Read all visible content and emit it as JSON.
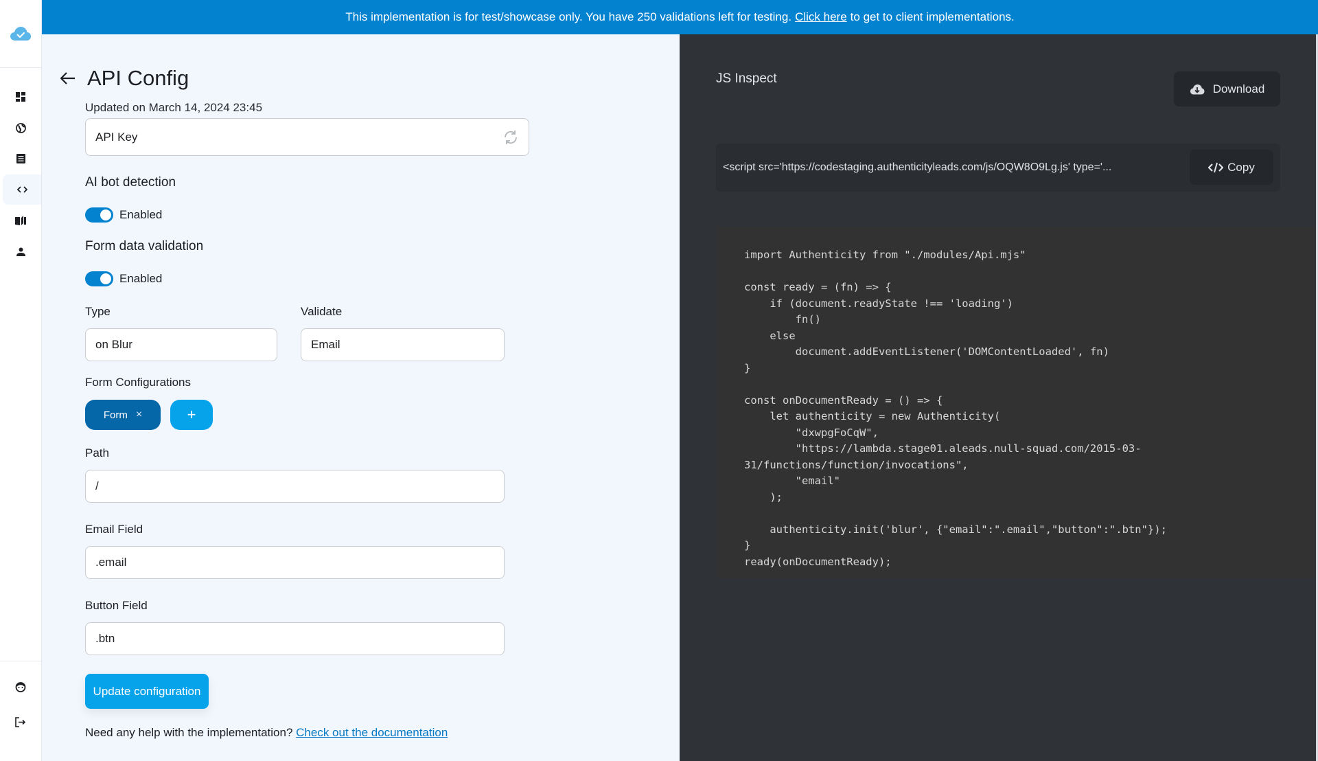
{
  "banner": {
    "text_before": "This implementation is for test/showcase only. You have 250 validations left for testing.",
    "link": "Click here",
    "text_after": "to get to client implementations.",
    "color": "#0382d0"
  },
  "sidebar": {
    "logo_icon": "cloud-check-icon",
    "items": [
      {
        "icon": "dashboard-icon",
        "active": false
      },
      {
        "icon": "globe-icon",
        "active": false
      },
      {
        "icon": "list-icon",
        "active": false
      },
      {
        "icon": "code-icon",
        "active": true
      },
      {
        "icon": "book-icon",
        "active": false
      },
      {
        "icon": "user-icon",
        "active": false
      }
    ],
    "bottom_items": [
      {
        "icon": "support-agent-icon"
      },
      {
        "icon": "logout-icon"
      }
    ]
  },
  "page": {
    "title": "API Config",
    "updated": "Updated on March 14, 2024 23:45",
    "api_key": {
      "value": "API Key",
      "icon": "refresh-icon"
    },
    "ai_bot_detection": {
      "title": "AI bot detection",
      "toggle_label": "Enabled",
      "enabled": true
    },
    "form_data_validation": {
      "title": "Form data validation",
      "toggle_label": "Enabled",
      "enabled": true
    },
    "type": {
      "label": "Type",
      "value": "on Blur"
    },
    "validate": {
      "label": "Validate",
      "value": "Email"
    },
    "form_configurations": {
      "label": "Form Configurations",
      "chips": [
        {
          "label": "Form",
          "remove": "×"
        }
      ],
      "add_label": "+"
    },
    "path": {
      "label": "Path",
      "value": "/"
    },
    "email_field": {
      "label": "Email Field",
      "value": ".email"
    },
    "button_field": {
      "label": "Button Field",
      "value": ".btn"
    },
    "update_button": "Update configuration",
    "help": {
      "text": "Need any help with the implementation?",
      "link": "Check out the documentation"
    }
  },
  "inspect": {
    "title": "JS Inspect",
    "download_label": "Download",
    "script_tag": "<script src='https://codestaging.authenticityleads.com/js/OQW8O9Lg.js' type='...",
    "copy_label": "Copy",
    "code": "import Authenticity from \"./modules/Api.mjs\"\n\nconst ready = (fn) => {\n    if (document.readyState !== 'loading')\n        fn()\n    else\n        document.addEventListener('DOMContentLoaded', fn)\n}\n\nconst onDocumentReady = () => {\n    let authenticity = new Authenticity(\n        \"dxwpgFoCqW\",\n        \"https://lambda.stage01.aleads.null-squad.com/2015-03-\n31/functions/function/invocations\",\n        \"email\"\n    );\n\n    authenticity.init('blur', {\"email\":\".email\",\"button\":\".btn\"});\n}\nready(onDocumentReady);"
  }
}
